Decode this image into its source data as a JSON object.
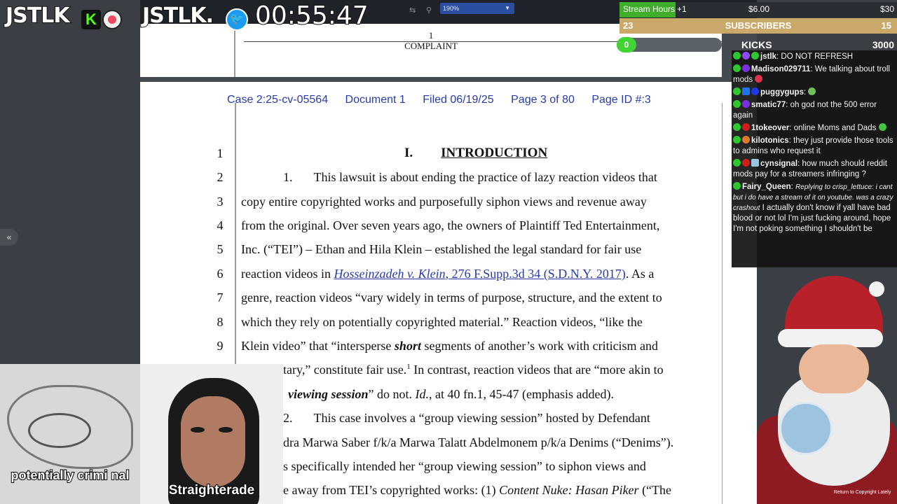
{
  "overlay": {
    "logo_1": "JSTLK",
    "kick_badge": "K",
    "logo_2": "JSTLK.",
    "twitter_icon": "twitter-icon",
    "timer": "00:55:47"
  },
  "toolbar": {
    "zoom_value": "190%"
  },
  "pdf": {
    "prev_page": {
      "page_number": "1",
      "label": "COMPLAINT"
    },
    "header": {
      "case": "Case 2:25-cv-05564",
      "document": "Document 1",
      "filed": "Filed 06/19/25",
      "page": "Page 3 of 80",
      "page_id": "Page ID #:3"
    },
    "heading": {
      "number": "I.",
      "title": "INTRODUCTION"
    },
    "line_numbers": [
      "1",
      "2",
      "3",
      "4",
      "5",
      "6",
      "7",
      "8",
      "9"
    ],
    "lines": {
      "l2_num": "1.",
      "l2": "This lawsuit is about ending the practice of lazy reaction videos that",
      "l3": "copy entire copyrighted works and purposefully siphon views and revenue away",
      "l4": "from the original. Over seven years ago, the owners of Plaintiff Ted Entertainment,",
      "l5": "Inc. (“TEI”) – Ethan and Hila Klein – established the legal standard for fair use",
      "l6_pre": "reaction videos in ",
      "l6_cite_case": "Hosseinzadeh v. Klein",
      "l6_cite_rest": ", 276 F.Supp.3d 34 (S.D.N.Y. 2017)",
      "l6_post": ". As a",
      "l7": "genre, reaction videos “vary widely in terms of purpose, structure, and the extent to",
      "l8": "which they rely on potentially copyrighted material.” Reaction videos, “like the",
      "l9_pre": "Klein video” that “intersperse ",
      "l9_em": "short",
      "l9_post": " segments of another’s work with criticism and",
      "l10": "ntary,” constitute fair use.",
      "l10_sup": "1",
      "l10_post": "  In contrast, reaction videos that are “more akin to",
      "l11_em": "viewing session",
      "l11_post": "” do not. ",
      "l11_id": "Id.",
      "l11_end": ", at 40 fn.1, 45-47 (emphasis added).",
      "l12_num": "2.",
      "l12": "This case involves a “group viewing session” hosted by Defendant",
      "l13": "dra Marwa Saber f/k/a Marwa Talatt Abdelmonem p/k/a Denims (“Denims”).",
      "l14": "s specifically intended her “group viewing session” to siphon views and",
      "l15_pre": "e away from TEI’s copyrighted works: (1) ",
      "l15_em": "Content Nuke: Hasan Piker",
      "l15_post": " (“The"
    }
  },
  "widgets": {
    "stream_hours": {
      "label": "Stream Hours",
      "increment": "+1",
      "mid_value": "$6.00",
      "end_value": "$30"
    },
    "subscribers": {
      "count": "23",
      "label": "SUBSCRIBERS",
      "goal": "15"
    },
    "kicks": {
      "count": "0",
      "label": "KICKS",
      "goal": "3000"
    }
  },
  "chat": [
    {
      "user": "jstlk",
      "text": "DO NOT REFRESH"
    },
    {
      "user": "Madison029711",
      "text": "We talking about troll mods"
    },
    {
      "user": "puggygups",
      "text": ""
    },
    {
      "user": "smatic77",
      "text": "oh god not the 500 error again"
    },
    {
      "user": "1tokeover",
      "text": "online Moms and Dads"
    },
    {
      "user": "kilotonics",
      "text": "they just provide those tools to admins who request it"
    },
    {
      "user": "cynsignal",
      "text": "how much should reddit mods pay for a streamers infringing ?"
    },
    {
      "user": "Fairy_Queen",
      "reply": "Replying to crisp_lettuce: i cant but i do have a stream of it on youtube. was a crazy crashout",
      "text": "I actually don't know if yall have bad blood or not lol I'm just fucking around, hope I'm not poking something I shouldn't be"
    }
  ],
  "cams": {
    "meme_caption": "potentially crimi nal",
    "vtuber_name": "Straighterade"
  },
  "santa_footer": "Return to Copyright Lately"
}
